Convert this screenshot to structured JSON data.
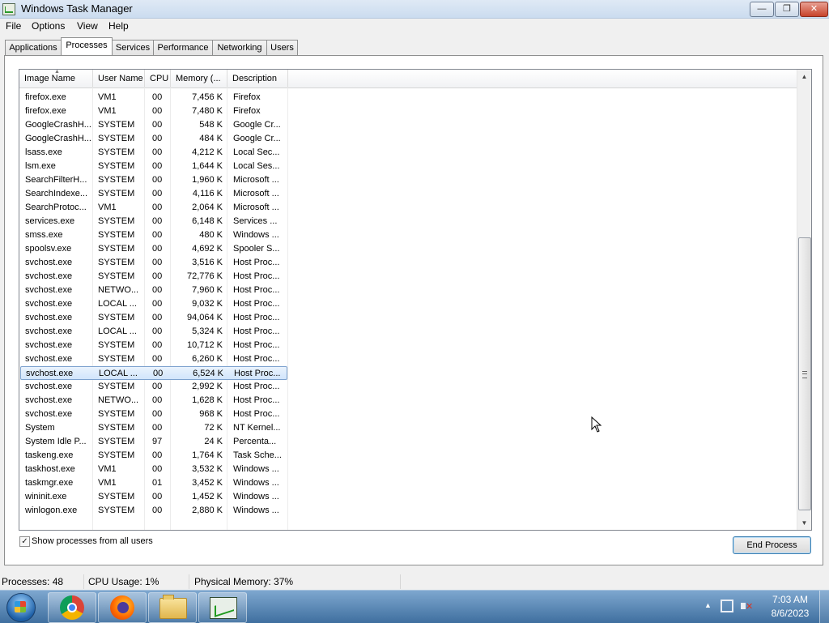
{
  "window": {
    "title": "Windows Task Manager",
    "buttons": {
      "minimize": "—",
      "maximize": "❐",
      "close": "✕"
    }
  },
  "menu": [
    "File",
    "Options",
    "View",
    "Help"
  ],
  "tabs": [
    "Applications",
    "Processes",
    "Services",
    "Performance",
    "Networking",
    "Users"
  ],
  "active_tab": "Processes",
  "columns": [
    "Image Name",
    "User Name",
    "CPU",
    "Memory (...",
    "Description"
  ],
  "processes": [
    {
      "name": "firefox.exe",
      "user": "VM1",
      "cpu": "00",
      "memory": "7,456 K",
      "description": "Firefox"
    },
    {
      "name": "firefox.exe",
      "user": "VM1",
      "cpu": "00",
      "memory": "7,480 K",
      "description": "Firefox"
    },
    {
      "name": "GoogleCrashH...",
      "user": "SYSTEM",
      "cpu": "00",
      "memory": "548 K",
      "description": "Google Cr..."
    },
    {
      "name": "GoogleCrashH...",
      "user": "SYSTEM",
      "cpu": "00",
      "memory": "484 K",
      "description": "Google Cr..."
    },
    {
      "name": "lsass.exe",
      "user": "SYSTEM",
      "cpu": "00",
      "memory": "4,212 K",
      "description": "Local Sec..."
    },
    {
      "name": "lsm.exe",
      "user": "SYSTEM",
      "cpu": "00",
      "memory": "1,644 K",
      "description": "Local Ses..."
    },
    {
      "name": "SearchFilterH...",
      "user": "SYSTEM",
      "cpu": "00",
      "memory": "1,960 K",
      "description": "Microsoft ..."
    },
    {
      "name": "SearchIndexe...",
      "user": "SYSTEM",
      "cpu": "00",
      "memory": "4,116 K",
      "description": "Microsoft ..."
    },
    {
      "name": "SearchProtoc...",
      "user": "VM1",
      "cpu": "00",
      "memory": "2,064 K",
      "description": "Microsoft ..."
    },
    {
      "name": "services.exe",
      "user": "SYSTEM",
      "cpu": "00",
      "memory": "6,148 K",
      "description": "Services ..."
    },
    {
      "name": "smss.exe",
      "user": "SYSTEM",
      "cpu": "00",
      "memory": "480 K",
      "description": "Windows ..."
    },
    {
      "name": "spoolsv.exe",
      "user": "SYSTEM",
      "cpu": "00",
      "memory": "4,692 K",
      "description": "Spooler S..."
    },
    {
      "name": "svchost.exe",
      "user": "SYSTEM",
      "cpu": "00",
      "memory": "3,516 K",
      "description": "Host Proc..."
    },
    {
      "name": "svchost.exe",
      "user": "SYSTEM",
      "cpu": "00",
      "memory": "72,776 K",
      "description": "Host Proc..."
    },
    {
      "name": "svchost.exe",
      "user": "NETWO...",
      "cpu": "00",
      "memory": "7,960 K",
      "description": "Host Proc..."
    },
    {
      "name": "svchost.exe",
      "user": "LOCAL ...",
      "cpu": "00",
      "memory": "9,032 K",
      "description": "Host Proc..."
    },
    {
      "name": "svchost.exe",
      "user": "SYSTEM",
      "cpu": "00",
      "memory": "94,064 K",
      "description": "Host Proc..."
    },
    {
      "name": "svchost.exe",
      "user": "LOCAL ...",
      "cpu": "00",
      "memory": "5,324 K",
      "description": "Host Proc..."
    },
    {
      "name": "svchost.exe",
      "user": "SYSTEM",
      "cpu": "00",
      "memory": "10,712 K",
      "description": "Host Proc..."
    },
    {
      "name": "svchost.exe",
      "user": "SYSTEM",
      "cpu": "00",
      "memory": "6,260 K",
      "description": "Host Proc..."
    },
    {
      "name": "svchost.exe",
      "user": "LOCAL ...",
      "cpu": "00",
      "memory": "6,524 K",
      "description": "Host Proc...",
      "selected": true
    },
    {
      "name": "svchost.exe",
      "user": "SYSTEM",
      "cpu": "00",
      "memory": "2,992 K",
      "description": "Host Proc..."
    },
    {
      "name": "svchost.exe",
      "user": "NETWO...",
      "cpu": "00",
      "memory": "1,628 K",
      "description": "Host Proc..."
    },
    {
      "name": "svchost.exe",
      "user": "SYSTEM",
      "cpu": "00",
      "memory": "968 K",
      "description": "Host Proc..."
    },
    {
      "name": "System",
      "user": "SYSTEM",
      "cpu": "00",
      "memory": "72 K",
      "description": "NT Kernel..."
    },
    {
      "name": "System Idle P...",
      "user": "SYSTEM",
      "cpu": "97",
      "memory": "24 K",
      "description": "Percenta..."
    },
    {
      "name": "taskeng.exe",
      "user": "SYSTEM",
      "cpu": "00",
      "memory": "1,764 K",
      "description": "Task Sche..."
    },
    {
      "name": "taskhost.exe",
      "user": "VM1",
      "cpu": "00",
      "memory": "3,532 K",
      "description": "Windows ..."
    },
    {
      "name": "taskmgr.exe",
      "user": "VM1",
      "cpu": "01",
      "memory": "3,452 K",
      "description": "Windows ..."
    },
    {
      "name": "wininit.exe",
      "user": "SYSTEM",
      "cpu": "00",
      "memory": "1,452 K",
      "description": "Windows ..."
    },
    {
      "name": "winlogon.exe",
      "user": "SYSTEM",
      "cpu": "00",
      "memory": "2,880 K",
      "description": "Windows ..."
    }
  ],
  "show_all_users": {
    "label": "Show processes from all users",
    "checked": true,
    "mark": "✓"
  },
  "end_process_label": "End Process",
  "status": {
    "processes": "Processes: 48",
    "cpu_usage": "CPU Usage: 1%",
    "physical_memory": "Physical Memory: 37%"
  },
  "taskbar": {
    "apps": [
      "chrome-icon",
      "firefox-icon",
      "windows-explorer-icon",
      "task-manager-icon"
    ],
    "tray_arrow": "▲",
    "clock_time": "7:03 AM",
    "clock_date": "8/6/2023"
  },
  "scrollbar": {
    "up": "▲",
    "down": "▼"
  }
}
